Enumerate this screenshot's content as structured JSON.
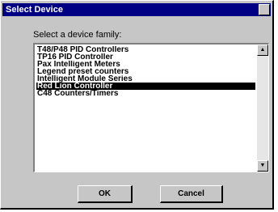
{
  "window": {
    "title": "Select Device"
  },
  "prompt": "Select a device family:",
  "devices": [
    "T48/P48 PID Controllers",
    "TP16 PID Controller",
    "Pax Intelligent Meters",
    "Legend preset counters",
    "Intelligent Module Series",
    "Red Lion Controller",
    "C48 Counters/Timers"
  ],
  "selected_index": 5,
  "buttons": {
    "ok": "OK",
    "cancel": "Cancel"
  },
  "icons": {
    "scroll_up": "▲",
    "scroll_down": "▼"
  }
}
